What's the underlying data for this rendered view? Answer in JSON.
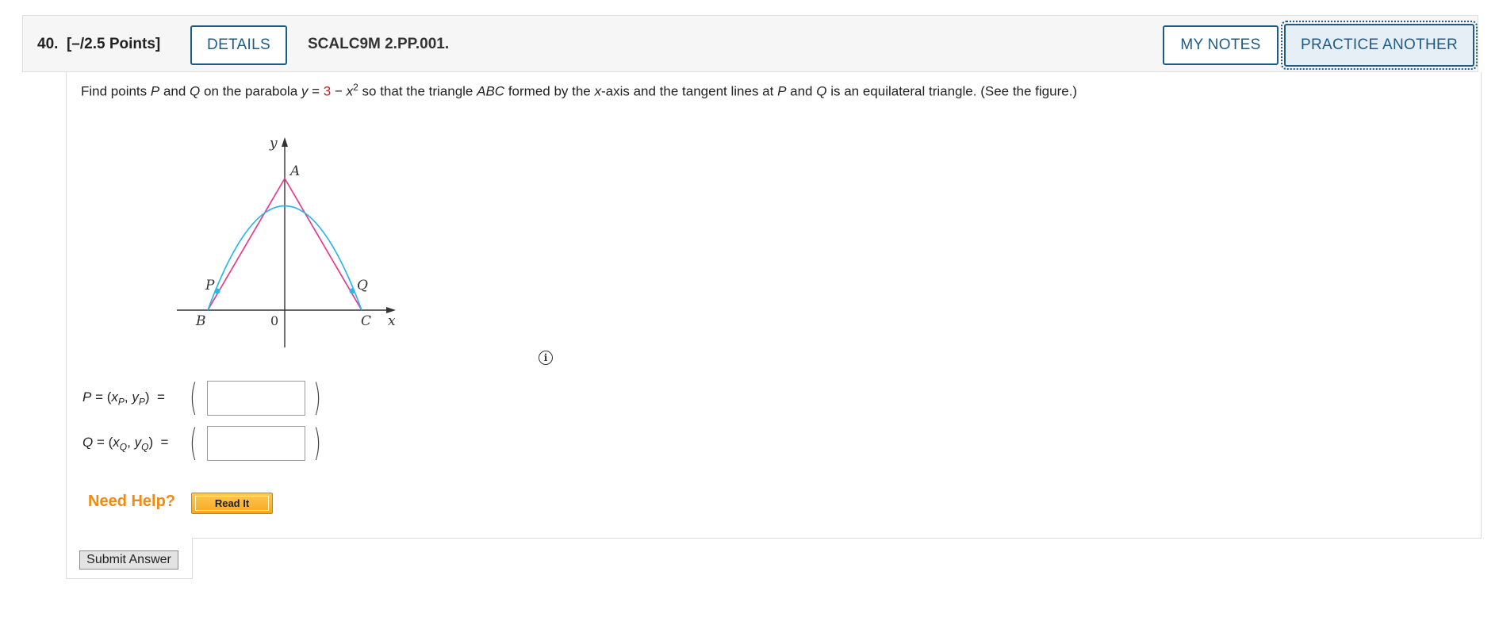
{
  "question": {
    "number": "40.",
    "points": "[–/2.5 Points]",
    "code": "SCALC9M 2.PP.001."
  },
  "buttons": {
    "details": "DETAILS",
    "my_notes": "MY NOTES",
    "practice_another": "PRACTICE ANOTHER",
    "read_it": "Read It",
    "submit": "Submit Answer"
  },
  "problem": {
    "t1": "Find points ",
    "p": "P",
    "t2": " and ",
    "q": "Q",
    "t3": " on the parabola ",
    "y": "y",
    "t4": " = ",
    "const": "3",
    "t5": " − ",
    "x": "x",
    "exp": "2",
    "t6": " so that the triangle ",
    "abc": "ABC",
    "t7": " formed by the ",
    "xaxis": "x",
    "t8": "-axis and the tangent lines at ",
    "p2": "P",
    "t9": " and ",
    "q2": "Q",
    "t10": " is an equilateral triangle. (See the figure.)"
  },
  "figure": {
    "labels": {
      "y": "y",
      "x": "x",
      "a": "A",
      "b": "B",
      "c": "C",
      "p": "P",
      "q": "Q",
      "origin": "0"
    },
    "colors": {
      "triangle": "#e33d8f",
      "parabola": "#2db7e6",
      "axes": "#333333"
    }
  },
  "info_icon": "i",
  "answers": [
    {
      "lhs": "P",
      "eq": "=",
      "var1": "x",
      "sub1": "P",
      "var2": "y",
      "sub2": "P",
      "eq2": "="
    },
    {
      "lhs": "Q",
      "eq": "=",
      "var1": "x",
      "sub1": "Q",
      "var2": "y",
      "sub2": "Q",
      "eq2": "="
    }
  ],
  "help": {
    "label": "Need Help?"
  },
  "colors": {
    "accent": "#1d5a86",
    "help": "#f08a10",
    "highlight": "#cc1f1f"
  }
}
